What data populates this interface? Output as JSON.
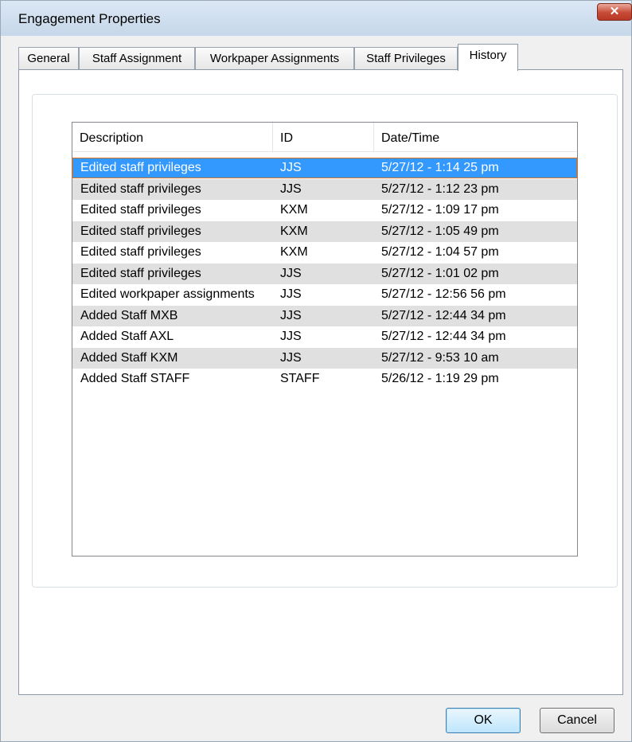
{
  "window": {
    "title": "Engagement Properties",
    "close_glyph": "✕"
  },
  "tabs": [
    {
      "label": "General"
    },
    {
      "label": "Staff Assignment"
    },
    {
      "label": "Workpaper Assignments"
    },
    {
      "label": "Staff Privileges"
    },
    {
      "label": "History",
      "active": true
    }
  ],
  "history": {
    "columns": [
      "Description",
      "ID",
      "Date/Time"
    ],
    "rows": [
      {
        "description": "Edited staff privileges",
        "id": "JJS",
        "datetime": "5/27/12 - 1:14 25 pm",
        "selected": true
      },
      {
        "description": "Edited staff privileges",
        "id": "JJS",
        "datetime": "5/27/12 - 1:12 23 pm"
      },
      {
        "description": "Edited staff privileges",
        "id": "KXM",
        "datetime": "5/27/12 - 1:09 17 pm"
      },
      {
        "description": "Edited staff privileges",
        "id": "KXM",
        "datetime": "5/27/12 - 1:05 49 pm"
      },
      {
        "description": "Edited staff privileges",
        "id": "KXM",
        "datetime": "5/27/12 - 1:04 57 pm"
      },
      {
        "description": "Edited staff privileges",
        "id": "JJS",
        "datetime": "5/27/12 - 1:01 02 pm"
      },
      {
        "description": "Edited workpaper assignments",
        "id": "JJS",
        "datetime": "5/27/12 - 12:56 56 pm"
      },
      {
        "description": "Added Staff MXB",
        "id": "JJS",
        "datetime": "5/27/12 - 12:44 34 pm"
      },
      {
        "description": "Added Staff AXL",
        "id": "JJS",
        "datetime": "5/27/12 - 12:44 34 pm"
      },
      {
        "description": "Added Staff KXM",
        "id": "JJS",
        "datetime": "5/27/12 - 9:53 10 am"
      },
      {
        "description": "Added Staff STAFF",
        "id": "STAFF",
        "datetime": "5/26/12 - 1:19 29 pm"
      }
    ]
  },
  "buttons": {
    "ok": "OK",
    "cancel": "Cancel"
  },
  "colors": {
    "selection": "#3399ff",
    "stripe": "#e0e0e0",
    "close": "#c74a36"
  }
}
